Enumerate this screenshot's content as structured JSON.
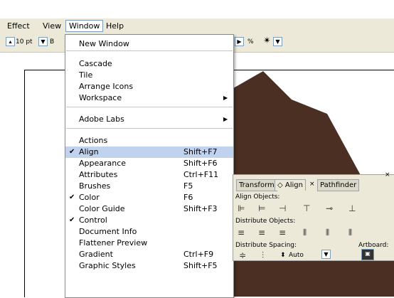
{
  "titlebar": {
    "text": ""
  },
  "menubar": {
    "items": [
      "Effect",
      "View",
      "Window",
      "Help"
    ]
  },
  "toolbar": {
    "font_size": "10 pt",
    "b_label": "B",
    "percent": "%"
  },
  "window_menu": {
    "items": [
      {
        "label": "New Window",
        "shortcut": "",
        "checked": false,
        "submenu": false
      },
      {
        "label": "Cascade",
        "shortcut": "",
        "checked": false,
        "submenu": false
      },
      {
        "label": "Tile",
        "shortcut": "",
        "checked": false,
        "submenu": false
      },
      {
        "label": "Arrange Icons",
        "shortcut": "",
        "checked": false,
        "submenu": false
      },
      {
        "label": "Workspace",
        "shortcut": "",
        "checked": false,
        "submenu": true
      },
      {
        "label": "Adobe Labs",
        "shortcut": "",
        "checked": false,
        "submenu": true
      },
      {
        "label": "Actions",
        "shortcut": "",
        "checked": false,
        "submenu": false
      },
      {
        "label": "Align",
        "shortcut": "Shift+F7",
        "checked": true,
        "submenu": false
      },
      {
        "label": "Appearance",
        "shortcut": "Shift+F6",
        "checked": false,
        "submenu": false
      },
      {
        "label": "Attributes",
        "shortcut": "Ctrl+F11",
        "checked": false,
        "submenu": false
      },
      {
        "label": "Brushes",
        "shortcut": "F5",
        "checked": false,
        "submenu": false
      },
      {
        "label": "Color",
        "shortcut": "F6",
        "checked": true,
        "submenu": false
      },
      {
        "label": "Color Guide",
        "shortcut": "Shift+F3",
        "checked": false,
        "submenu": false
      },
      {
        "label": "Control",
        "shortcut": "",
        "checked": true,
        "submenu": false
      },
      {
        "label": "Document Info",
        "shortcut": "",
        "checked": false,
        "submenu": false
      },
      {
        "label": "Flattener Preview",
        "shortcut": "",
        "checked": false,
        "submenu": false
      },
      {
        "label": "Gradient",
        "shortcut": "Ctrl+F9",
        "checked": false,
        "submenu": false
      },
      {
        "label": "Graphic Styles",
        "shortcut": "Shift+F5",
        "checked": false,
        "submenu": false
      }
    ]
  },
  "align_panel": {
    "tabs": [
      "Transform",
      "◇ Align",
      "×",
      "Pathfinder"
    ],
    "align_objects": "Align Objects:",
    "distribute_objects": "Distribute Objects:",
    "distribute_spacing": "Distribute Spacing:",
    "artboard": "Artboard:",
    "spacing_value": "Auto",
    "close": "×"
  },
  "colors": {
    "menu_bg": "#ffffff",
    "menu_highlight": "#c1d2ee",
    "chrome": "#ece9d8",
    "star": "#4a2f22"
  }
}
